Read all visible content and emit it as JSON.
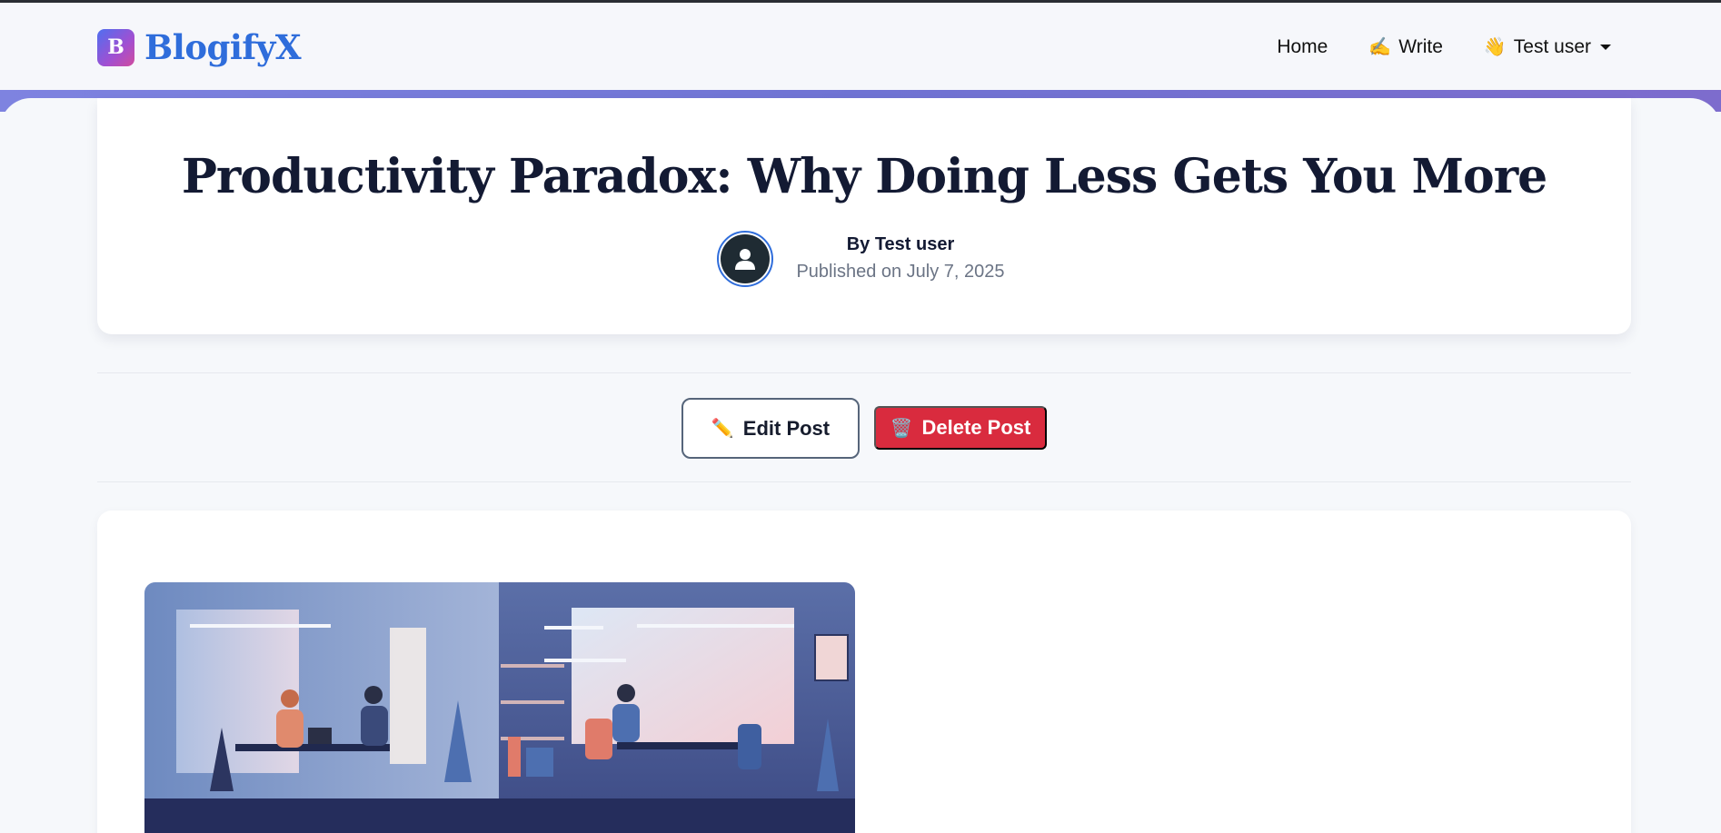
{
  "navbar": {
    "brand_letter": "B",
    "brand_name": "BlogifyX",
    "links": [
      {
        "emoji": "",
        "label": "Home"
      },
      {
        "emoji": "✍️",
        "label": "Write"
      },
      {
        "emoji": "👋",
        "label": "Test user"
      }
    ],
    "user_menu_icon": "caret-down-icon"
  },
  "post": {
    "title": "Productivity Paradox: Why Doing Less Gets You More",
    "author_line": "By Test user",
    "published_line": "Published on July 7, 2025",
    "avatar_icon": "user-avatar-icon"
  },
  "actions": {
    "edit_emoji": "✏️",
    "edit_label": "Edit Post",
    "delete_emoji": "🗑️",
    "delete_label": "Delete Post"
  },
  "colors": {
    "brand": "#2f6ddb",
    "accent_bar": "#7379d8",
    "delete": "#d92b3e",
    "title": "#131a33"
  }
}
